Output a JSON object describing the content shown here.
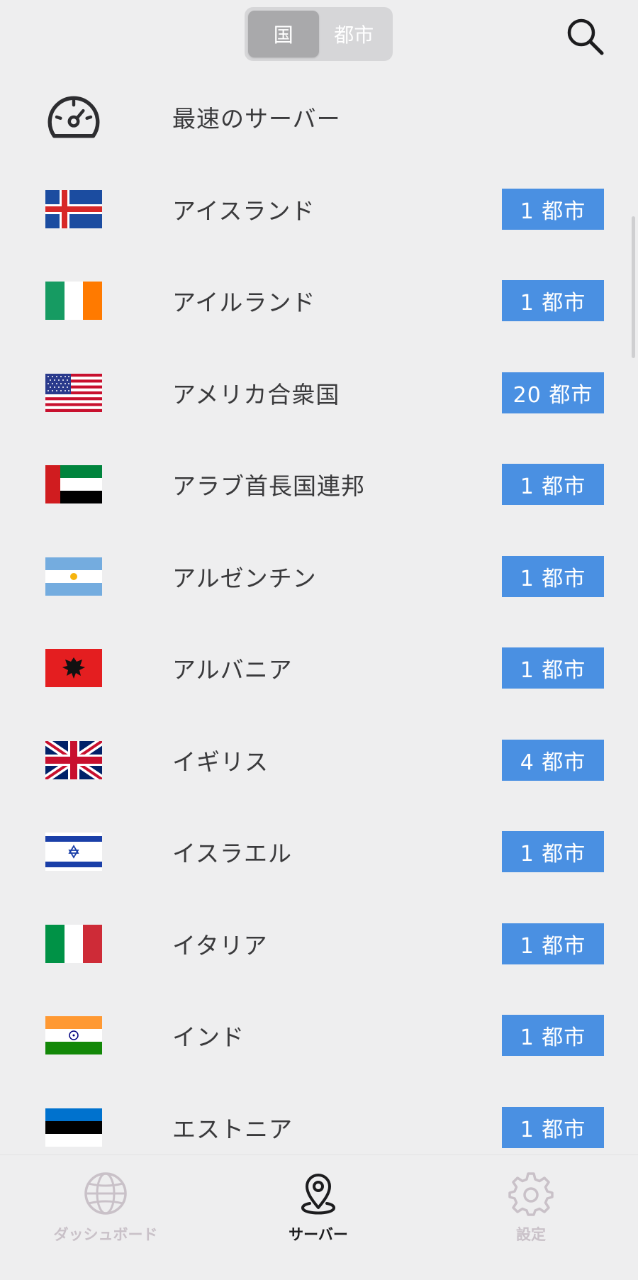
{
  "header": {
    "segments": [
      {
        "label": "国",
        "active": true
      },
      {
        "label": "都市",
        "active": false
      }
    ],
    "search_icon": "search-icon"
  },
  "fastest": {
    "label": "最速のサーバー",
    "icon": "speedometer-icon"
  },
  "countries": [
    {
      "name": "アイスランド",
      "cities": "1 都市",
      "flag": "iceland"
    },
    {
      "name": "アイルランド",
      "cities": "1 都市",
      "flag": "ireland"
    },
    {
      "name": "アメリカ合衆国",
      "cities": "20 都市",
      "flag": "usa"
    },
    {
      "name": "アラブ首長国連邦",
      "cities": "1 都市",
      "flag": "uae"
    },
    {
      "name": "アルゼンチン",
      "cities": "1 都市",
      "flag": "argentina"
    },
    {
      "name": "アルバニア",
      "cities": "1 都市",
      "flag": "albania"
    },
    {
      "name": "イギリス",
      "cities": "4 都市",
      "flag": "uk"
    },
    {
      "name": "イスラエル",
      "cities": "1 都市",
      "flag": "israel"
    },
    {
      "name": "イタリア",
      "cities": "1 都市",
      "flag": "italy"
    },
    {
      "name": "インド",
      "cities": "1 都市",
      "flag": "india"
    },
    {
      "name": "エストニア",
      "cities": "1 都市",
      "flag": "estonia"
    }
  ],
  "tabbar": {
    "dashboard": "ダッシュボード",
    "servers": "サーバー",
    "settings": "設定"
  },
  "colors": {
    "badge": "#4a90e2",
    "background": "#eeeeef",
    "tab_inactive": "#c9c1c8",
    "tab_active": "#1c1c1e"
  }
}
